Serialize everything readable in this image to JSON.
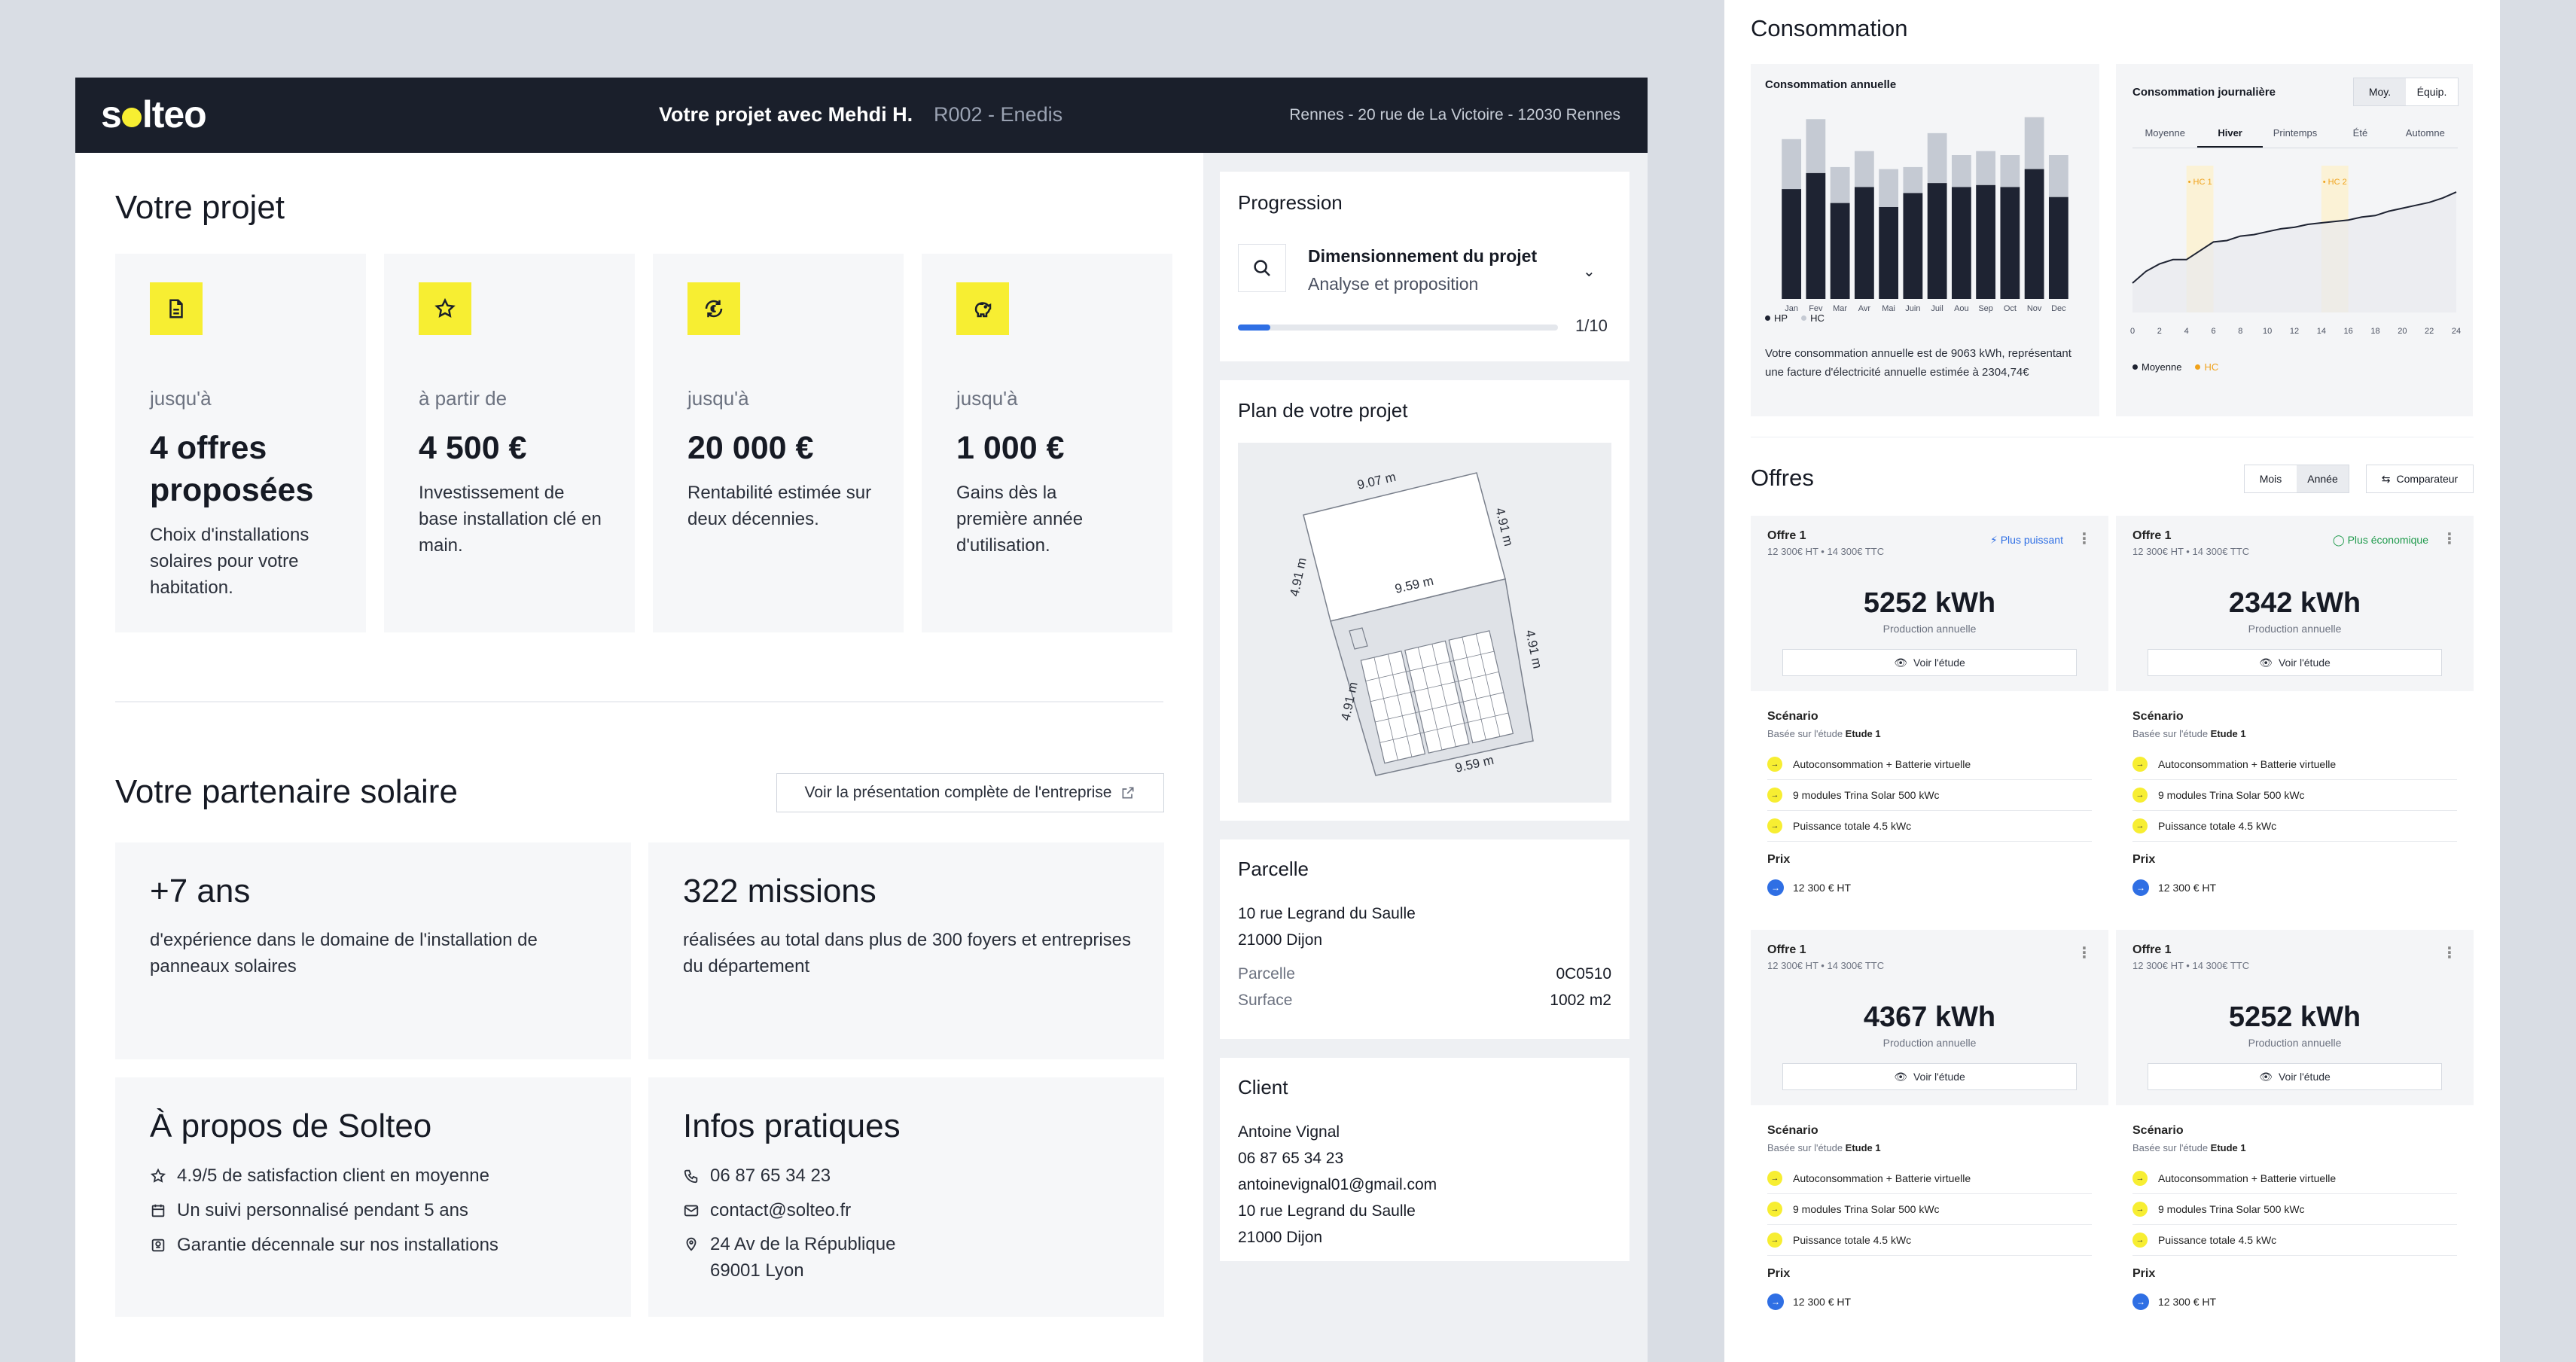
{
  "header": {
    "logo": "solteo",
    "project_title": "Votre projet avec Mehdi H.",
    "project_code": "R002 - Enedis",
    "address": "Rennes - 20 rue de La Victoire - 12030 Rennes"
  },
  "project": {
    "title": "Votre projet",
    "cards": [
      {
        "icon": "document-icon",
        "prefix": "jusqu'à",
        "value": "4 offres proposées",
        "desc": "Choix d'installations solaires pour votre habitation."
      },
      {
        "icon": "star-icon",
        "prefix": "à partir de",
        "value": "4 500 €",
        "desc": "Investissement de base installation clé en main."
      },
      {
        "icon": "euro-refresh-icon",
        "prefix": "jusqu'à",
        "value": "20 000 €",
        "desc": "Rentabilité estimée sur deux décennies."
      },
      {
        "icon": "piggy-bank-icon",
        "prefix": "jusqu'à",
        "value": "1 000 €",
        "desc": "Gains dès la première année d'utilisation."
      }
    ]
  },
  "partner": {
    "title": "Votre partenaire solaire",
    "button": "Voir la présentation complète de l'entreprise",
    "stats": [
      {
        "value": "+7 ans",
        "desc": "d'expérience dans le domaine de l'installation de panneaux solaires"
      },
      {
        "value": "322 missions",
        "desc": "réalisées au total dans plus de 300 foyers et entreprises du département"
      }
    ],
    "about": {
      "title": "À propos de Solteo",
      "items": [
        {
          "icon": "star-icon",
          "text": "4.9/5 de satisfaction client en moyenne"
        },
        {
          "icon": "calendar-icon",
          "text": "Un suivi personnalisé pendant 5 ans"
        },
        {
          "icon": "badge-icon",
          "text": "Garantie décennale sur nos installations"
        }
      ]
    },
    "infos": {
      "title": "Infos pratiques",
      "phone": "06 87 65 34 23",
      "email": "contact@solteo.fr",
      "address1": "24 Av de la République",
      "address2": "69001 Lyon"
    }
  },
  "progress": {
    "title": "Progression",
    "step_title": "Dimensionnement du projet",
    "step_sub": "Analyse et proposition",
    "counter": "1/10",
    "fraction": 0.1
  },
  "plan": {
    "title": "Plan de votre projet",
    "labels": {
      "top": "9.07 m",
      "right_upper": "4.91 m",
      "middle": "9.59 m",
      "left_upper": "4.91 m",
      "left_lower": "4.91 m",
      "right_lower": "4.91 m",
      "bottom": "9.59 m"
    }
  },
  "parcel": {
    "title": "Parcelle",
    "address1": "10 rue Legrand du Saulle",
    "address2": "21000 Dijon",
    "rows": [
      {
        "label": "Parcelle",
        "value": "0C0510"
      },
      {
        "label": "Surface",
        "value": "1002 m2"
      }
    ]
  },
  "client": {
    "title": "Client",
    "name": "Antoine Vignal",
    "phone": "06 87 65 34 23",
    "email": "antoinevignal01@gmail.com",
    "address1": "10 rue Legrand du Saulle",
    "address2": "21000 Dijon"
  },
  "consumption": {
    "title": "Consommation",
    "annual": {
      "title": "Consommation annuelle",
      "legend_hp": "HP",
      "legend_hc": "HC",
      "text": "Votre consommation annuelle est de 9063 kWh, représentant une facture d'électricité annuelle estimée à 2304,74€"
    },
    "daily": {
      "title": "Consommation journalière",
      "toggle": [
        "Moy.",
        "Équip."
      ],
      "seasons": [
        "Moyenne",
        "Hiver",
        "Printemps",
        "Été",
        "Automne"
      ],
      "active_season": "Hiver",
      "hc_labels": [
        "HC 1",
        "HC 2"
      ],
      "legend_avg": "Moyenne",
      "legend_hc": "HC"
    }
  },
  "chart_data": [
    {
      "type": "bar",
      "title": "Consommation annuelle",
      "categories": [
        "Jan",
        "Fev",
        "Mar",
        "Avr",
        "Mai",
        "Juin",
        "Juil",
        "Aou",
        "Sep",
        "Oct",
        "Nov",
        "Dec"
      ],
      "series": [
        {
          "name": "HP",
          "values": [
            55,
            63,
            48,
            56,
            46,
            53,
            58,
            56,
            57,
            56,
            65,
            51
          ]
        },
        {
          "name": "HC",
          "values": [
            25,
            27,
            18,
            18,
            19,
            13,
            25,
            16,
            17,
            16,
            26,
            21
          ]
        }
      ],
      "ylim": [
        0,
        95
      ]
    },
    {
      "type": "line",
      "title": "Consommation journalière",
      "x": [
        0,
        1,
        2,
        3,
        4,
        5,
        6,
        7,
        8,
        9,
        10,
        11,
        12,
        13,
        14,
        15,
        16,
        17,
        18,
        19,
        20,
        21,
        22,
        23,
        24
      ],
      "xticks": [
        0,
        2,
        4,
        6,
        8,
        10,
        12,
        14,
        16,
        18,
        20,
        22,
        24
      ],
      "series": [
        {
          "name": "Moyenne",
          "values": [
            20,
            28,
            33,
            36,
            36,
            42,
            48,
            49,
            52,
            53,
            55,
            57,
            58,
            60,
            61,
            62,
            63,
            65,
            66,
            69,
            71,
            73,
            75,
            78,
            82
          ]
        }
      ],
      "hc_ranges": [
        [
          4,
          6
        ],
        [
          14,
          16
        ]
      ],
      "ylim": [
        0,
        100
      ]
    }
  ],
  "offers": {
    "title": "Offres",
    "toggle": [
      "Mois",
      "Année"
    ],
    "active_toggle": "Année",
    "compare_button": "Comparateur",
    "items": [
      {
        "name": "Offre 1",
        "price_line": "12 300€ HT • 14 300€ TTC",
        "badge": "Plus puissant",
        "badge_type": "power",
        "kwh": "5252 kWh",
        "prod_label": "Production annuelle",
        "view_button": "Voir l'étude",
        "scenario": "Scénario",
        "based_prefix": "Basée sur l'étude",
        "based_study": "Etude 1",
        "features": [
          "Autoconsommation + Batterie virtuelle",
          "9 modules Trina Solar 500 kWc",
          "Puissance totale 4.5 kWc"
        ],
        "price_label": "Prix",
        "price": "12 300 € HT"
      },
      {
        "name": "Offre 1",
        "price_line": "12 300€ HT • 14 300€ TTC",
        "badge": "Plus économique",
        "badge_type": "eco",
        "kwh": "2342 kWh",
        "prod_label": "Production annuelle",
        "view_button": "Voir l'étude",
        "scenario": "Scénario",
        "based_prefix": "Basée sur l'étude",
        "based_study": "Etude 1",
        "features": [
          "Autoconsommation + Batterie virtuelle",
          "9 modules Trina Solar 500 kWc",
          "Puissance totale 4.5 kWc"
        ],
        "price_label": "Prix",
        "price": "12 300 € HT"
      },
      {
        "name": "Offre 1",
        "price_line": "12 300€ HT • 14 300€ TTC",
        "badge": "",
        "badge_type": "",
        "kwh": "4367 kWh",
        "prod_label": "Production annuelle",
        "view_button": "Voir l'étude",
        "scenario": "Scénario",
        "based_prefix": "Basée sur l'étude",
        "based_study": "Etude 1",
        "features": [
          "Autoconsommation + Batterie virtuelle",
          "9 modules Trina Solar 500 kWc",
          "Puissance totale 4.5 kWc"
        ],
        "price_label": "Prix",
        "price": "12 300 € HT"
      },
      {
        "name": "Offre 1",
        "price_line": "12 300€ HT • 14 300€ TTC",
        "badge": "",
        "badge_type": "",
        "kwh": "5252 kWh",
        "prod_label": "Production annuelle",
        "view_button": "Voir l'étude",
        "scenario": "Scénario",
        "based_prefix": "Basée sur l'étude",
        "based_study": "Etude 1",
        "features": [
          "Autoconsommation + Batterie virtuelle",
          "9 modules Trina Solar 500 kWc",
          "Puissance totale 4.5 kWc"
        ],
        "price_label": "Prix",
        "price": "12 300 € HT"
      }
    ]
  },
  "colors": {
    "brand_yellow": "#f7ee32",
    "dark": "#1a1f2b",
    "hp_bar": "#1e2332",
    "hc_bar": "#c5cad3",
    "accent_blue": "#2f6fe4",
    "eco_green": "#1f9a4c",
    "hc_orange": "#f0a21b"
  }
}
